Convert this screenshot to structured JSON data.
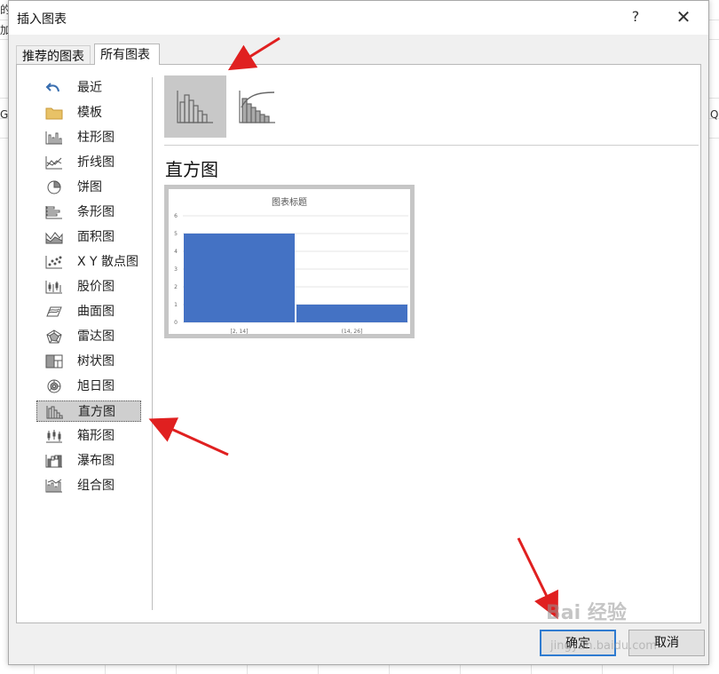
{
  "background": {
    "fragments": [
      "的",
      "加",
      "G",
      "Q"
    ]
  },
  "dialog": {
    "title": "插入图表",
    "help_glyph": "?",
    "close_glyph": "✕",
    "tabs": [
      {
        "label": "推荐的图表",
        "active": false
      },
      {
        "label": "所有图表",
        "active": true
      }
    ],
    "sidebar": [
      {
        "label": "最近",
        "icon": "undo-icon"
      },
      {
        "label": "模板",
        "icon": "folder-icon"
      },
      {
        "label": "柱形图",
        "icon": "column-chart-icon"
      },
      {
        "label": "折线图",
        "icon": "line-chart-icon"
      },
      {
        "label": "饼图",
        "icon": "pie-chart-icon"
      },
      {
        "label": "条形图",
        "icon": "bar-chart-icon"
      },
      {
        "label": "面积图",
        "icon": "area-chart-icon"
      },
      {
        "label": "X Y 散点图",
        "icon": "scatter-chart-icon"
      },
      {
        "label": "股价图",
        "icon": "stock-chart-icon"
      },
      {
        "label": "曲面图",
        "icon": "surface-chart-icon"
      },
      {
        "label": "雷达图",
        "icon": "radar-chart-icon"
      },
      {
        "label": "树状图",
        "icon": "treemap-chart-icon"
      },
      {
        "label": "旭日图",
        "icon": "sunburst-chart-icon"
      },
      {
        "label": "直方图",
        "icon": "histogram-chart-icon",
        "selected": true
      },
      {
        "label": "箱形图",
        "icon": "box-whisker-chart-icon"
      },
      {
        "label": "瀑布图",
        "icon": "waterfall-chart-icon"
      },
      {
        "label": "组合图",
        "icon": "combo-chart-icon"
      }
    ],
    "subtypes": [
      {
        "icon": "histogram-subtype-icon",
        "selected": true
      },
      {
        "icon": "pareto-subtype-icon",
        "selected": false
      }
    ],
    "chart_type_title": "直方图",
    "buttons": {
      "ok": "确定",
      "cancel": "取消"
    },
    "accent_color": "#2f7bd0"
  },
  "chart_data": {
    "type": "bar",
    "title": "图表标题",
    "categories": [
      "[2, 14]",
      "(14, 26]"
    ],
    "values": [
      5,
      1
    ],
    "ylim": [
      0,
      6
    ],
    "yticks": [
      0,
      1,
      2,
      3,
      4,
      5,
      6
    ],
    "bar_color": "#4472c4",
    "grid": true
  },
  "watermark": {
    "text": "Bai 经验",
    "sub": "jingyan.baidu.com"
  }
}
